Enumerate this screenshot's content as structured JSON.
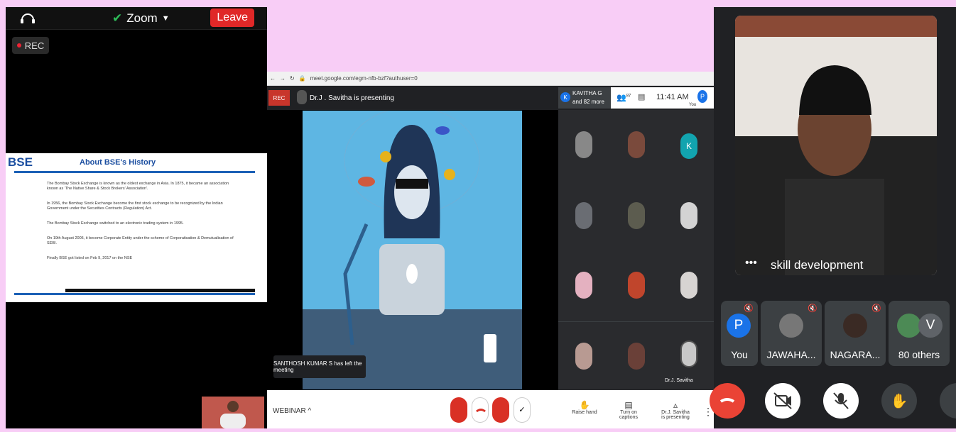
{
  "zoom": {
    "title": "Zoom",
    "leave_label": "Leave",
    "rec_label": "REC",
    "slide": {
      "logo": "BSE",
      "title": "About BSE's History",
      "bullets": [
        "The Bombay Stock Exchange is known as the oldest exchange in Asia. In 1875, it became an association known as 'The Native Share & Stock Brokers' Association'.",
        "In 1956, the Bombay Stock Exchange become the first stock exchange to be recognized by the Indian Government under the Securities Contracts (Regulation) Act.",
        "The Bombay Stock Exchange switched to an electronic trading system in 1995.",
        "On 19th August 2005, it become Corporate Entity under the scheme of Corporatisation & Demutualisation of SEBI.",
        "Finally BSE got listed on Feb 9, 2017 on the NSE"
      ]
    }
  },
  "meet_browser": {
    "url": "meet.google.com/egm-nfb-bzf?authuser=0",
    "rec_label": "REC",
    "presenter": "Dr.J . Savitha is presenting",
    "kavitha_line1": "KAVITHA G",
    "kavitha_line2": "and 82 more",
    "clock": "11:41 AM",
    "people_count": "87",
    "you_label": "You",
    "toast": "SANTHOSH KUMAR S has left the meeting",
    "webinar": "WEBINAR",
    "raise_hand": "Raise hand",
    "captions": "Turn on captions",
    "presenting_line1": "Dr.J. Savitha",
    "presenting_line2": "is presenting",
    "tile_name": "Dr.J. Savitha",
    "tile_k": "K"
  },
  "gmeet": {
    "main_name": "skill development",
    "participants": [
      {
        "avatar": "P",
        "label": "You"
      },
      {
        "avatar": "",
        "label": "JAWAHA..."
      },
      {
        "avatar": "",
        "label": "NAGARA..."
      },
      {
        "avatar": "V",
        "label": "80 others"
      }
    ]
  },
  "colors": {
    "leave": "#e02828",
    "rec": "#c8352b",
    "end_call": "#ea4335",
    "avatar_p": "#1a73e8",
    "avatar_k": "#12a4af"
  }
}
